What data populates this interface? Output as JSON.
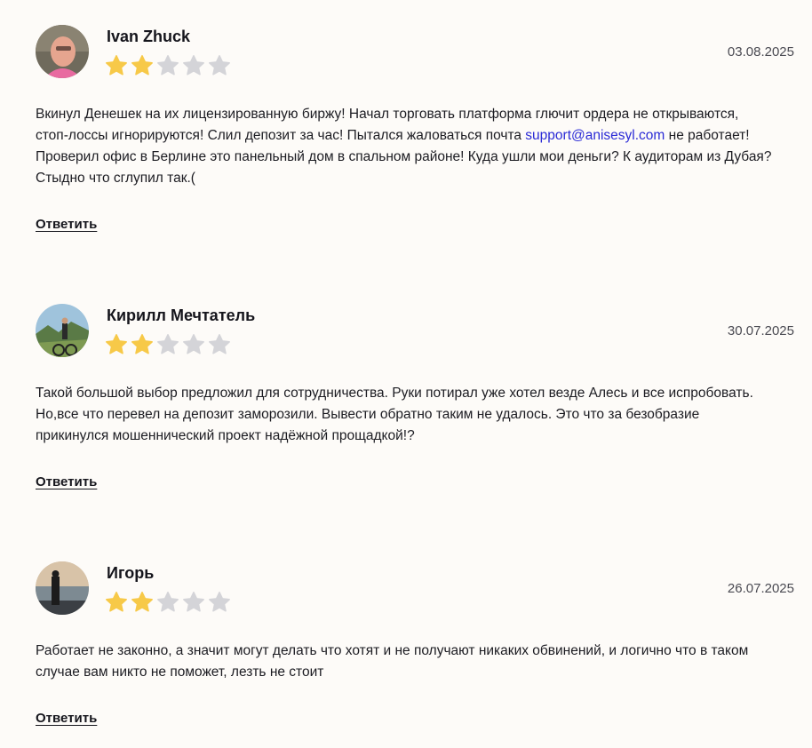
{
  "reviews": [
    {
      "name": "Ivan Zhuck",
      "date": "03.08.2025",
      "rating": 2,
      "max_rating": 5,
      "text_before": "Вкинул Денешек на их лицензированную биржу! Начал торговать платформа глючит ордера не открываются, стоп-лоссы игнорируются! Слил депозит за час! Пытался жаловаться почта ",
      "email": "support@anisesyl.com",
      "text_after": " не работает! Проверил офис в Берлине это панельный дом в спальном районе! Куда ушли мои деньги? К аудиторам из Дубая? Стыдно что сглупил так.(",
      "reply_label": "Ответить"
    },
    {
      "name": "Кирилл Мечтатель",
      "date": "30.07.2025",
      "rating": 2,
      "max_rating": 5,
      "text": "Такой большой выбор предложил для сотрудничества. Руки потирал уже хотел везде Алесь и все испробовать. Но,все что перевел на депозит заморозили. Вывести обратно таким не удалось. Это что за безобразие прикинулся мошеннический проект надёжной прощадкой!?",
      "reply_label": "Ответить"
    },
    {
      "name": "Игорь",
      "date": "26.07.2025",
      "rating": 2,
      "max_rating": 5,
      "text": "Работает не законно, а значит могут делать что хотят и не получают никаких обвинений, и логично что в таком случае вам никто не поможет, лезть не стоит",
      "reply_label": "Ответить"
    }
  ],
  "colors": {
    "star_filled": "#f7c948",
    "star_empty": "#d4d4d8",
    "link": "#2b2bd6",
    "background": "#fdfbf8"
  }
}
